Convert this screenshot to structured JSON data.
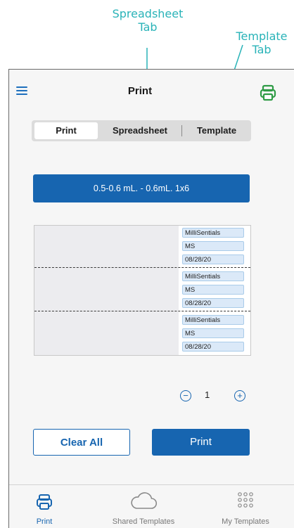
{
  "annotations": {
    "spreadsheet_tab": [
      "Spreadsheet",
      "Tab"
    ],
    "template_tab": [
      "Template",
      "Tab"
    ]
  },
  "header": {
    "title": "Print",
    "menu_icon": "hamburger-icon",
    "printer_icon": "printer-icon"
  },
  "tabs": [
    {
      "label": "Print",
      "active": true
    },
    {
      "label": "Spreadsheet",
      "active": false
    },
    {
      "label": "Template",
      "active": false
    }
  ],
  "size_selector": "0.5-0.6 mL. - 0.6mL.  1x6",
  "sheet": {
    "labels": [
      [
        "MilliSentials",
        "MS",
        "08/28/20"
      ],
      [
        "MilliSentials",
        "MS",
        "08/28/20"
      ],
      [
        "MilliSentials",
        "MS",
        "08/28/20"
      ]
    ]
  },
  "quantity": {
    "minus": "−",
    "value": "1",
    "plus": "+"
  },
  "actions": {
    "clear": "Clear All",
    "print": "Print"
  },
  "bottom_nav": [
    {
      "label": "Print",
      "icon": "printer-icon",
      "active": true
    },
    {
      "label": "Shared Templates",
      "icon": "cloud-icon",
      "active": false
    },
    {
      "label": "My Templates",
      "icon": "grid-icon",
      "active": false
    }
  ],
  "colors": {
    "accent": "#1765b0",
    "annotation": "#29b3b8",
    "printer_green": "#2e9b45"
  }
}
